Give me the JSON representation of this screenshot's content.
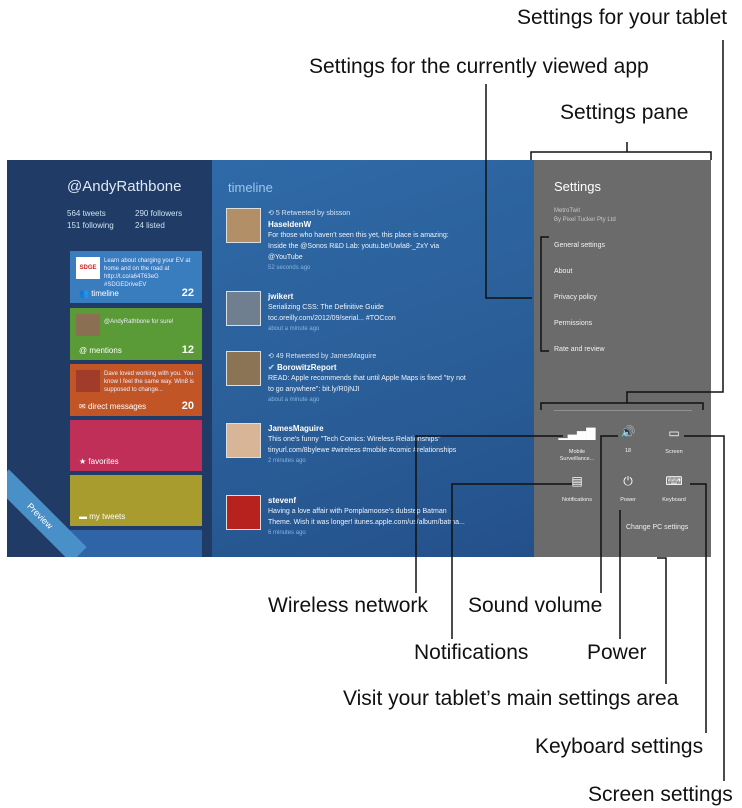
{
  "callouts": {
    "tablet": "Settings for your tablet",
    "app": "Settings for the currently viewed app",
    "pane": "Settings pane",
    "wireless": "Wireless network",
    "volume": "Sound volume",
    "notifications": "Notifications",
    "power": "Power",
    "main_settings": "Visit your tablet’s main settings area",
    "keyboard": "Keyboard settings",
    "screen": "Screen settings"
  },
  "app": {
    "username": "@AndyRathbone",
    "stats": {
      "tweets": "564 tweets",
      "followers": "290 followers",
      "following": "151 following",
      "listed": "24 listed"
    },
    "tiles": [
      {
        "label": "timeline",
        "count": "22",
        "text": "Learn about charging your EV at home and on the road at http://t.co/a64T63eG #SDGEDriveEV",
        "color": "#3a7dbf",
        "icon": "users-icon"
      },
      {
        "label": "mentions",
        "count": "12",
        "text": "@AndyRathbone for sure!",
        "color": "#5a9a37",
        "icon": "at-icon"
      },
      {
        "label": "direct messages",
        "count": "20",
        "text": "Dave loved working with you. You know I feel the same way. Win8 is supposed to change...",
        "color": "#c15526",
        "icon": "mail-icon"
      },
      {
        "label": "favorites",
        "count": "",
        "text": "",
        "color": "#c02f57",
        "icon": "star-icon"
      },
      {
        "label": "my tweets",
        "count": "",
        "text": "",
        "color": "#a79c2d",
        "icon": "chat-icon"
      }
    ],
    "preview": "Preview",
    "timeline_header": "timeline",
    "tweets": [
      {
        "meta": "5  Retweeted by sbisson",
        "name": "HaseldenW",
        "text": "For those who haven't seen this yet, this place is amazing: Inside the @Sonos R&D Lab: youtu.be/Uwla8-_ZxY via @YouTube",
        "ago": "52 seconds ago"
      },
      {
        "meta": "",
        "name": "jwikert",
        "text": "Serializing CSS: The Definitive Guide toc.oreilly.com/2012/09/serial... #TOCcon",
        "ago": "about a minute ago"
      },
      {
        "meta": "49  Retweeted by JamesMaguire",
        "name": "BorowitzReport",
        "text": "READ: Apple recommends that until Apple Maps is fixed \"try not to go anywhere\": bit.ly/R0jNJI",
        "ago": "about a minute ago"
      },
      {
        "meta": "",
        "name": "JamesMaguire",
        "text": "This one's funny \"Tech Comics: Wireless Relationships\" tinyurl.com/8bylewe #wireless #mobile #comic #relationships",
        "ago": "2 minutes ago"
      },
      {
        "meta": "",
        "name": "stevenf",
        "text": "Having a love affair with Pomplamoose's dubstep Batman Theme. Wish it was longer! itunes.apple.com/us/album/batma...",
        "ago": "6 minutes ago"
      }
    ]
  },
  "settings_pane": {
    "title": "Settings",
    "app_name": "MetroTwit",
    "app_by": "By Pixel Tucker Pty Ltd",
    "items": [
      "General settings",
      "About",
      "Privacy policy",
      "Permissions",
      "Rate and review"
    ],
    "buttons": [
      {
        "label": "Mobile Surveillance...",
        "icon": "wireless-icon"
      },
      {
        "label": "18",
        "icon": "volume-icon"
      },
      {
        "label": "Screen",
        "icon": "screen-icon"
      },
      {
        "label": "Notifications",
        "icon": "notifications-icon"
      },
      {
        "label": "Power",
        "icon": "power-icon"
      },
      {
        "label": "Keyboard",
        "icon": "keyboard-icon"
      }
    ],
    "change_pc": "Change PC settings"
  }
}
